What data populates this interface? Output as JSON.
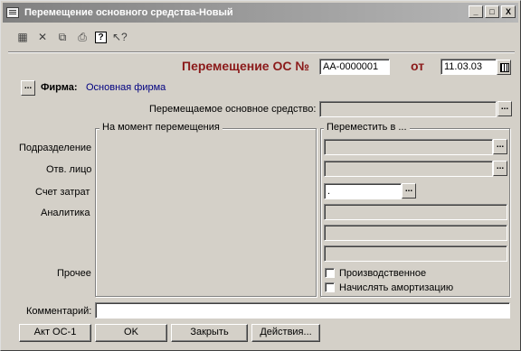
{
  "window": {
    "title": "Перемещение основного средства-Новый",
    "controls": {
      "minimize": "_",
      "maximize": "□",
      "close": "X"
    }
  },
  "toolbar": {
    "icons": [
      "doc-props-icon",
      "doc-delete-icon",
      "doc-copy-icon",
      "doc-print-icon",
      "help-icon",
      "context-help-icon"
    ]
  },
  "header": {
    "doc_title": "Перемещение ОС №",
    "doc_number": "АА-0000001",
    "from_label": "от",
    "doc_date": "11.03.03"
  },
  "firm": {
    "button_label": "...",
    "label": "Фирма:",
    "value": "Основная фирма"
  },
  "asset": {
    "label": "Перемещаемое основное средство:",
    "value": ""
  },
  "left_group": {
    "title": "На момент перемещения"
  },
  "right_group": {
    "title": "Переместить в ..."
  },
  "row_labels": {
    "division": "Подразделение",
    "responsible": "Отв. лицо",
    "cost_account": "Счет затрат",
    "analytics": "Аналитика",
    "other": "Прочее"
  },
  "right_fields": {
    "division": "",
    "responsible": "",
    "cost_account": ".",
    "analytics_1": "",
    "analytics_2": "",
    "analytics_3": ""
  },
  "checkboxes": {
    "productive": {
      "label": "Производственное",
      "checked": false
    },
    "depreciation": {
      "label": "Начислять амортизацию",
      "checked": false
    }
  },
  "comment": {
    "label": "Комментарий:",
    "value": ""
  },
  "buttons": {
    "act": "Акт ОС-1",
    "ok": "OK",
    "close": "Закрыть",
    "actions": "Действия..."
  },
  "colors": {
    "doc_title": "#8b1a1a",
    "firm_value": "#000080",
    "window_bg": "#d4d0c8"
  }
}
